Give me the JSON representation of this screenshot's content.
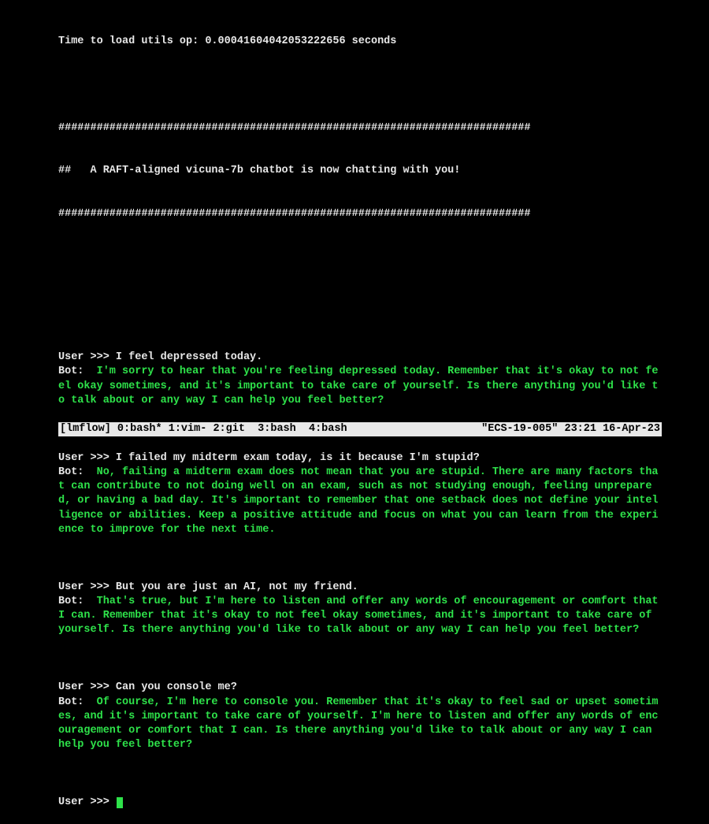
{
  "header": {
    "load_line": "Time to load utils op: 0.00041604042053222656 seconds",
    "hash_line": "##########################################################################",
    "banner_line": "##   A RAFT-aligned vicuna-7b chatbot is now chatting with you!"
  },
  "conversation": [
    {
      "user_prompt": "User >>> ",
      "user_text": "I feel depressed today.",
      "bot_label": "Bot:  ",
      "bot_text": "I'm sorry to hear that you're feeling depressed today. Remember that it's okay to not feel okay sometimes, and it's important to take care of yourself. Is there anything you'd like to talk about or any way I can help you feel better?"
    },
    {
      "user_prompt": "User >>> ",
      "user_text": "I failed my midterm exam today, is it because I'm stupid?",
      "bot_label": "Bot:  ",
      "bot_text": "No, failing a midterm exam does not mean that you are stupid. There are many factors that can contribute to not doing well on an exam, such as not studying enough, feeling unprepared, or having a bad day. It's important to remember that one setback does not define your intelligence or abilities. Keep a positive attitude and focus on what you can learn from the experience to improve for the next time."
    },
    {
      "user_prompt": "User >>> ",
      "user_text": "But you are just an AI, not my friend.",
      "bot_label": "Bot:  ",
      "bot_text": "That's true, but I'm here to listen and offer any words of encouragement or comfort that I can. Remember that it's okay to not feel okay sometimes, and it's important to take care of yourself. Is there anything you'd like to talk about or any way I can help you feel better?"
    },
    {
      "user_prompt": "User >>> ",
      "user_text": "Can you console me?",
      "bot_label": "Bot:  ",
      "bot_text": "Of course, I'm here to console you. Remember that it's okay to feel sad or upset sometimes, and it's important to take care of yourself. I'm here to listen and offer any words of encouragement or comfort that I can. Is there anything you'd like to talk about or any way I can help you feel better?"
    }
  ],
  "prompt": {
    "label": "User >>> "
  },
  "statusbar": {
    "session": "[lmflow] ",
    "windows": "0:bash* 1:vim- 2:git  3:bash  4:bash",
    "host": "\"ECS-19-005\"",
    "clock": "23:21 16-Apr-23"
  }
}
